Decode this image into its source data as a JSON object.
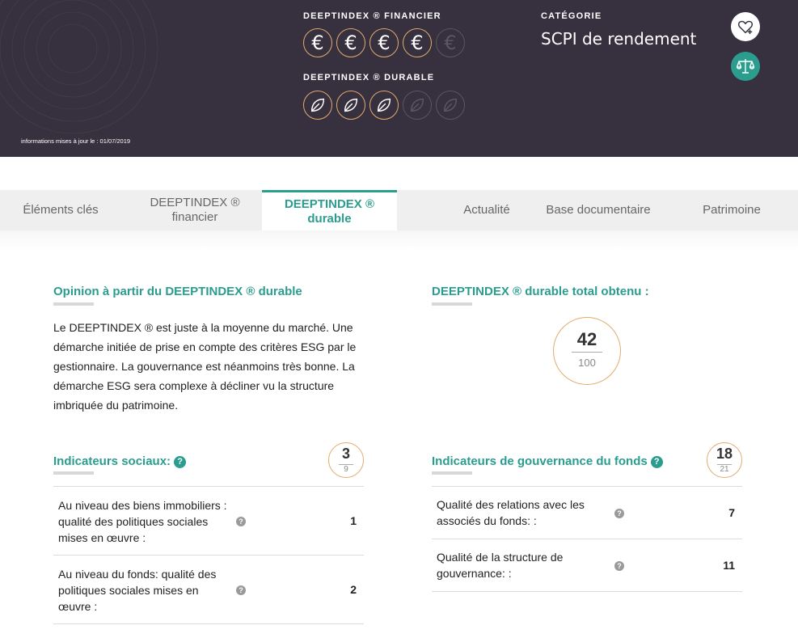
{
  "header": {
    "financier_label": "DEEPTINDEX ® FINANCIER",
    "financier_icons": [
      "€",
      "€",
      "€",
      "€",
      "€"
    ],
    "financier_score": 4,
    "financier_max": 5,
    "durable_label": "DEEPTINDEX ® DURABLE",
    "durable_score": 3,
    "durable_max": 5,
    "categorie_label": "CATÉGORIE",
    "categorie_value": "SCPI de rendement",
    "update_text": "informations mises à jour le : 01/07/2019",
    "favorite_icon": "heart-plus-icon",
    "compare_icon": "balance-scale-icon"
  },
  "tabs": [
    {
      "label": "Éléments clés",
      "active": false
    },
    {
      "label": "DEEPTINDEX ®\nfinancier",
      "active": false
    },
    {
      "label": "DEEPTINDEX ®\ndurable",
      "active": true
    },
    {
      "label": "Actualité",
      "active": false
    },
    {
      "label": "Base documentaire",
      "active": false
    },
    {
      "label": "Patrimoine",
      "active": false
    }
  ],
  "opinion": {
    "title": "Opinion à partir du DEEPTINDEX ® durable",
    "text": "Le DEEPTINDEX ® est juste à la moyenne du marché. Une démarche initiée de prise en compte des critères ESG par le gestionnaire. La gouvernance est néanmoins très bonne. La démarche ESG sera complexe à décliner vu la structure imbriquée du patrimoine."
  },
  "total": {
    "title": "DEEPTINDEX ® durable total obtenu :",
    "score": "42",
    "max": "100"
  },
  "social": {
    "title": "Indicateurs sociaux:",
    "help": "?",
    "score": "3",
    "max": "9",
    "rows": [
      {
        "label": "Au niveau des biens immobiliers : qualité des politiques sociales mises en œuvre :",
        "help": "?",
        "value": "1"
      },
      {
        "label": "Au niveau du fonds: qualité des politiques sociales mises en œuvre :",
        "help": "?",
        "value": "2"
      }
    ]
  },
  "gouvernance": {
    "title": "Indicateurs de gouvernance du fonds",
    "help": "?",
    "score": "18",
    "max": "21",
    "rows": [
      {
        "label": "Qualité des relations avec les associés du fonds: :",
        "help": "?",
        "value": "7"
      },
      {
        "label": "Qualité de la structure de gouvernance: :",
        "help": "?",
        "value": "11"
      }
    ]
  },
  "colors": {
    "header_bg": "#36303f",
    "accent": "#2a9d8f",
    "gold": "#e3ab6e",
    "tab_bg": "#efefef"
  }
}
